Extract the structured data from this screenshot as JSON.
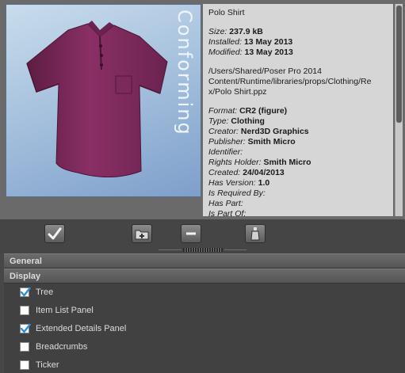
{
  "preview": {
    "tag": "Conforming",
    "subject": "purple polo shirt"
  },
  "details": {
    "name": "Polo Shirt",
    "size_label": "Size:",
    "size_value": "237.9 kB",
    "installed_label": "Installed:",
    "installed_value": "13 May 2013",
    "modified_label": "Modified:",
    "modified_value": "13 May 2013",
    "path_lines": [
      "/Users/Shared/Poser Pro 2014",
      "Content/Runtime/libraries/props/Clothing/Re",
      "x/Polo Shirt.ppz"
    ],
    "format_label": "Format:",
    "format_value": "CR2 (figure)",
    "type_label": "Type:",
    "type_value": "Clothing",
    "creator_label": "Creator:",
    "creator_value": "Nerd3D Graphics",
    "publisher_label": "Publisher:",
    "publisher_value": "Smith Micro",
    "identifier_label": "Identifier:",
    "rights_label": "Rights Holder:",
    "rights_value": "Smith Micro",
    "created_label": "Created:",
    "created_value": "24/04/2013",
    "version_label": "Has Version:",
    "version_value": "1.0",
    "required_label": "Is Required By:",
    "haspart_label": "Has Part:",
    "partof_label": "Is Part Of:"
  },
  "toolbar": {
    "apply_icon": "checkmark-icon",
    "add_icon": "add-to-library-icon",
    "remove_icon": "minus-icon",
    "options_icon": "bottle-icon"
  },
  "options": {
    "general_label": "General",
    "display_label": "Display",
    "items": [
      {
        "label": "Tree",
        "checked": true
      },
      {
        "label": "Item List Panel",
        "checked": false
      },
      {
        "label": "Extended Details Panel",
        "checked": true
      },
      {
        "label": "Breadcrumbs",
        "checked": false
      },
      {
        "label": "Ticker",
        "checked": false
      }
    ]
  },
  "colors": {
    "background": "#474747",
    "info_panel": "#d6d6d6",
    "shirt": "#7d2a5b",
    "check": "#2a8fd6"
  }
}
